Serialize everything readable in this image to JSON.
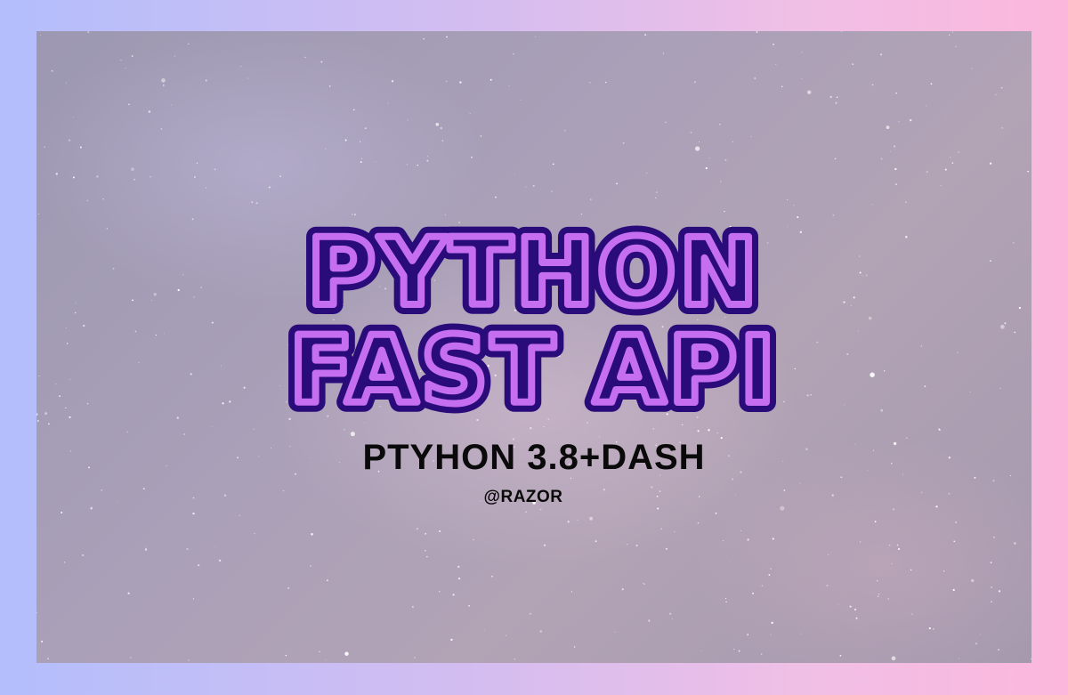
{
  "title": {
    "line1": "PYTHON",
    "line2": "FAST API"
  },
  "subtitle": "PTYHON 3.8+DASH",
  "author": "@RAZOR",
  "colors": {
    "neon_fill": "#c56ef0",
    "neon_outline": "#2a0b7a",
    "text": "#0a0a0a"
  }
}
